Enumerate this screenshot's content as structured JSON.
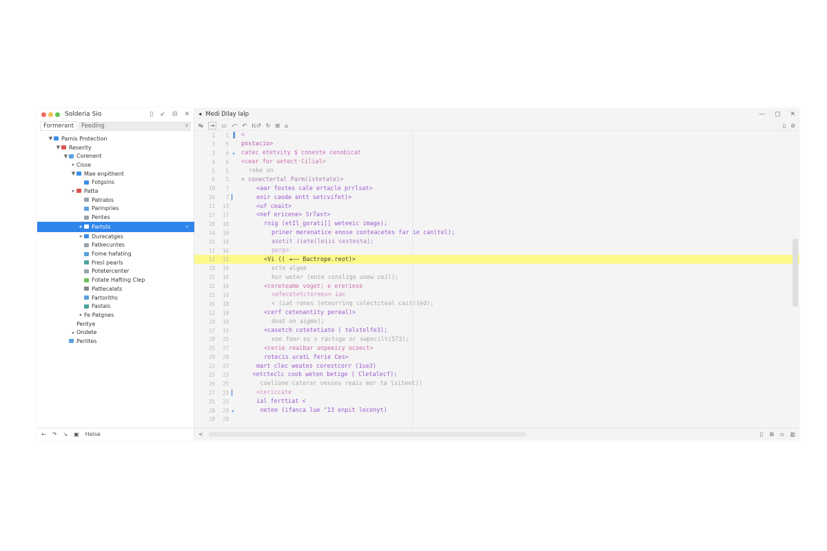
{
  "colors": {
    "selection": "#2f85ea",
    "highlight_line": "#fbf98a",
    "keyword_purple": "#9b59d0",
    "string_pink": "#d06ac4",
    "folder_blue": "#3a8ee6",
    "traffic_red": "#ed6a5e",
    "traffic_yellow": "#f5bf4f",
    "traffic_green": "#61c554"
  },
  "sidebar": {
    "title": "Solderia Sio",
    "actions": [
      "▯",
      "↙",
      "⊟",
      "✕"
    ],
    "tabs": [
      "Formerant",
      "Feeding"
    ],
    "filter_icon": "▿",
    "tree": [
      {
        "label": "Pamis Protection",
        "indent": 1,
        "twisty": "▼",
        "icon": "folder",
        "color": "#3a8ee6"
      },
      {
        "label": "Reserity",
        "indent": 2,
        "twisty": "▼",
        "icon": "folder",
        "color": "#d9534f"
      },
      {
        "label": "Corenent",
        "indent": 3,
        "twisty": "▼",
        "icon": "file",
        "color": "#5aa0e0"
      },
      {
        "label": "Cisse",
        "indent": 4,
        "twisty": "▸",
        "icon": "none",
        "color": ""
      },
      {
        "label": "Mae enpithent",
        "indent": 4,
        "twisty": "▼",
        "icon": "folder",
        "color": "#3a8ee6"
      },
      {
        "label": "Fotgsins",
        "indent": 5,
        "twisty": "",
        "icon": "folder",
        "color": "#3a8ee6"
      },
      {
        "label": "Patta",
        "indent": 4,
        "twisty": "▸",
        "icon": "folder",
        "color": "#d9534f"
      },
      {
        "label": "Patrabis",
        "indent": 5,
        "twisty": "",
        "icon": "file",
        "color": "#9aa3ad"
      },
      {
        "label": "Parinpries",
        "indent": 5,
        "twisty": "",
        "icon": "file",
        "color": "#5aa0e0"
      },
      {
        "label": "Pentes",
        "indent": 5,
        "twisty": "",
        "icon": "file",
        "color": "#9aa3ad"
      },
      {
        "label": "Partsts",
        "indent": 5,
        "twisty": "▸",
        "icon": "folder",
        "color": "#ffffff",
        "selected": true,
        "end": "▹"
      },
      {
        "label": "Durecatges",
        "indent": 5,
        "twisty": "▸",
        "icon": "folder",
        "color": "#3a8ee6"
      },
      {
        "label": "Fatkecuntes",
        "indent": 5,
        "twisty": "",
        "icon": "file",
        "color": "#9aa3ad"
      },
      {
        "label": "Fome hafating",
        "indent": 5,
        "twisty": "",
        "icon": "file",
        "color": "#5aa0e0"
      },
      {
        "label": "Fresl pearls",
        "indent": 5,
        "twisty": "",
        "icon": "file",
        "color": "#4aa3a0"
      },
      {
        "label": "Potetercenter",
        "indent": 5,
        "twisty": "",
        "icon": "file",
        "color": "#9aa3ad"
      },
      {
        "label": "Fotate Hafting Clep",
        "indent": 5,
        "twisty": "",
        "icon": "file",
        "color": "#6bbf5a"
      },
      {
        "label": "Pattecalats",
        "indent": 5,
        "twisty": "",
        "icon": "file",
        "color": "#888888"
      },
      {
        "label": "Fartoriths",
        "indent": 5,
        "twisty": "",
        "icon": "file",
        "color": "#5aa0e0"
      },
      {
        "label": "Fastals",
        "indent": 5,
        "twisty": "",
        "icon": "file",
        "color": "#4aa3a0"
      },
      {
        "label": "Fe Patgnes",
        "indent": 5,
        "twisty": "▸",
        "icon": "none",
        "color": ""
      },
      {
        "label": "Pentye",
        "indent": 4,
        "twisty": "",
        "icon": "none",
        "color": ""
      },
      {
        "label": "Ondete",
        "indent": 4,
        "twisty": "▸",
        "icon": "none",
        "color": ""
      },
      {
        "label": "Perlites",
        "indent": 3,
        "twisty": "",
        "icon": "file",
        "color": "#5aa0e0"
      }
    ],
    "status": {
      "back": "←",
      "forward": "↷",
      "next": "↘",
      "lock": "▣",
      "label": "Helse"
    }
  },
  "editor": {
    "title": "Medi Dilay Ialp",
    "title_icon": "◂",
    "window_controls": [
      "—",
      "▢",
      "✕"
    ],
    "toolbar_left": [
      "↹",
      "⇥",
      "▭",
      "⤺",
      "↶",
      "Ic↺",
      "↻",
      "⊞",
      "⌂"
    ],
    "toolbar_right": [
      "▯",
      "⊘"
    ],
    "lines": [
      {
        "n1": "1",
        "n2": "1",
        "mark": "▐",
        "text": "<",
        "indent": 0,
        "color": "#c37fc3"
      },
      {
        "n1": "3",
        "n2": "5",
        "mark": "",
        "text": "postacio>",
        "indent": 0,
        "color": "#b45ab4"
      },
      {
        "n1": "3",
        "n2": "4",
        "mark": "◂",
        "text": "catec etetvity $ coneste cenobicat",
        "indent": 0,
        "color": "#c76bbf"
      },
      {
        "n1": "4",
        "n2": "6",
        "mark": "",
        "text": "<cear for uetect·Cilial>",
        "indent": 0,
        "color": "#cd6ea7"
      },
      {
        "n1": "5",
        "n2": "5",
        "mark": "",
        "text": "reke on",
        "indent": 2,
        "color": "#a8a8a8"
      },
      {
        "n1": "6",
        "n2": "5",
        "mark": "",
        "text": "< conectertal  Parm(istetate)>",
        "indent": 0,
        "color": "#aa7ab0"
      },
      {
        "n1": "10",
        "n2": "7",
        "mark": "",
        "text": "<aar fostes cale ertacle prrlsat>",
        "indent": 4,
        "color": "#9b59d0"
      },
      {
        "n1": "16",
        "n2": "7",
        "mark": "▎",
        "text": "enir caode entt setcvifet)>",
        "indent": 4,
        "color": "#9b59d0"
      },
      {
        "n1": "11",
        "n2": "13",
        "mark": "",
        "text": "<uf ceait>",
        "indent": 4,
        "color": "#9b59d0"
      },
      {
        "n1": "17",
        "n2": "17",
        "mark": "",
        "text": "<nef ericene> Sr7ast>",
        "indent": 4,
        "color": "#9b59d0"
      },
      {
        "n1": "16",
        "n2": "18",
        "mark": "",
        "text": "rnig (etIl_gorati[]   weteeic image);",
        "indent": 6,
        "color": "#9b59d0"
      },
      {
        "n1": "14",
        "n2": "16",
        "mark": "",
        "text": "priner merenatice enose conteacetes far ie can(tel);",
        "indent": 8,
        "color": "#9b59d0"
      },
      {
        "n1": "15",
        "n2": "16",
        "mark": "",
        "text": "asetit (iete(leiis cestesta);",
        "indent": 8,
        "color": "#a97ac0"
      },
      {
        "n1": "17",
        "n2": "16",
        "mark": "",
        "text": "perp>",
        "indent": 8,
        "color": "#c2a0c8"
      },
      {
        "n1": "13",
        "n2": "15",
        "mark": "",
        "text": "<Vi (( ◂—— Bactrope.reot)>",
        "indent": 6,
        "color": "#4a4a2a",
        "highlight": true
      },
      {
        "n1": "18",
        "n2": "16",
        "mark": "",
        "text": "ecte algee",
        "indent": 8,
        "color": "#a8a8a8"
      },
      {
        "n1": "15",
        "n2": "18",
        "mark": "",
        "text": "hur weter (ente conslige unew ceil);",
        "indent": 8,
        "color": "#a8a8a8"
      },
      {
        "n1": "15",
        "n2": "18",
        "mark": "",
        "text": "<cereteame voget; e ereriese",
        "indent": 6,
        "color": "#cd6ea7"
      },
      {
        "n1": "15",
        "n2": "16",
        "mark": "",
        "text": "<efecetetctorees>            iac",
        "indent": 8,
        "color": "#cf8fc3"
      },
      {
        "n1": "16",
        "n2": "18",
        "mark": "",
        "text": "< (iat rones (eteorring colectcteal cait((ed);",
        "indent": 8,
        "color": "#a8a8a8"
      },
      {
        "n1": "12",
        "n2": "18",
        "mark": "",
        "text": "<cerf cetenantity pereal)>",
        "indent": 6,
        "color": "#9b59d0"
      },
      {
        "n1": "29",
        "n2": "19",
        "mark": "",
        "text": "doat on aigme);",
        "indent": 8,
        "color": "#a8a8a8"
      },
      {
        "n1": "37",
        "n2": "15",
        "mark": "",
        "text": "<casetch cotetetiate ( telstelfe3);",
        "indent": 6,
        "color": "#9b59d0"
      },
      {
        "n1": "28",
        "n2": "25",
        "mark": "",
        "text": "eoe foer es s  ractsge or swpecilt(573);",
        "indent": 8,
        "color": "#a8a8a8"
      },
      {
        "n1": "25",
        "n2": "27",
        "mark": "",
        "text": "<cerie reaibar unpeeicy ocoect>",
        "indent": 6,
        "color": "#cd6ea7"
      },
      {
        "n1": "29",
        "n2": "28",
        "mark": "",
        "text": "rotecis uratL ferie Ces>",
        "indent": 6,
        "color": "#9b59d0"
      },
      {
        "n1": "23",
        "n2": "33",
        "mark": "",
        "text": "mart clec weates corestcorr (1se3)",
        "indent": 4,
        "color": "#9b59d0"
      },
      {
        "n1": "25",
        "n2": "23",
        "mark": "",
        "text": "<etcteclc cook  weten betige ( Cletalecf);",
        "indent": 3,
        "color": "#9b59d0"
      },
      {
        "n1": "26",
        "n2": "25",
        "mark": "",
        "text": "coelione caterar  vesses reais  mor ta lsiteet))",
        "indent": 5,
        "color": "#a8a8a8"
      },
      {
        "n1": "27",
        "n2": "23",
        "mark": "▎",
        "text": "<cericcate",
        "indent": 4,
        "color": "#cf8fc3"
      },
      {
        "n1": "25",
        "n2": "25",
        "mark": "",
        "text": "ial ferttiat <",
        "indent": 4,
        "color": "#9b59d0"
      },
      {
        "n1": "28",
        "n2": "29",
        "mark": "▸",
        "text": "netee (ifanca lue \"13 enpit lecenyt)",
        "indent": 5,
        "color": "#9b59d0"
      },
      {
        "n1": "28",
        "n2": "28",
        "mark": "",
        "text": "",
        "indent": 0,
        "color": "#a8a8a8"
      }
    ],
    "status": {
      "left": "<",
      "right": [
        "▯",
        "⊞",
        "▫",
        "▥"
      ]
    }
  }
}
